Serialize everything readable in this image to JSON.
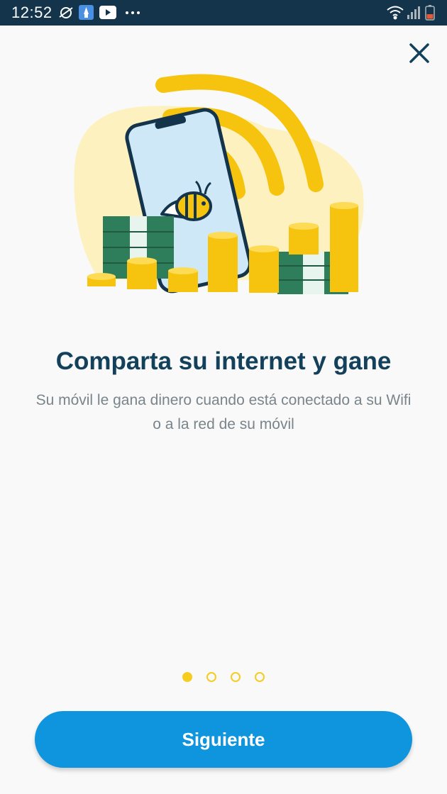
{
  "status_bar": {
    "time": "12:52",
    "left_icons": [
      "do-not-disturb-icon",
      "app-notification-icon",
      "youtube-icon",
      "more-dots-icon"
    ],
    "right_icons": [
      "wifi-icon",
      "signal-icon",
      "battery-icon"
    ],
    "battery_level": 0.2
  },
  "onboarding": {
    "title": "Comparta su internet y gane",
    "subtitle": "Su móvil le gana dinero cuando está conectado a su Wifi o a la red de su móvil",
    "page_count": 4,
    "active_page": 1,
    "next_label": "Siguiente"
  },
  "colors": {
    "status_bar": "#13344a",
    "title": "#13415b",
    "subtitle": "#79848b",
    "accent_yellow": "#f6cc1f",
    "button": "#0f95de",
    "money_green": "#2e7d5b"
  },
  "icons": {
    "close": "close-icon"
  }
}
